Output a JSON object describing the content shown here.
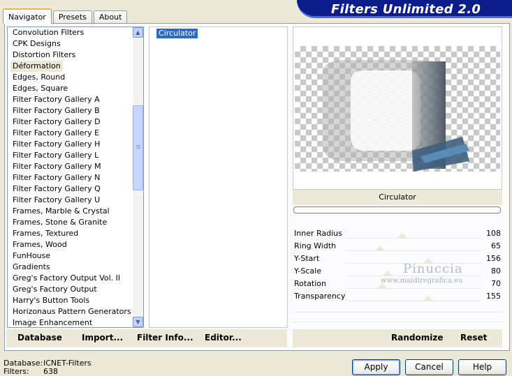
{
  "window": {
    "banner_title": "Filters Unlimited 2.0"
  },
  "tabs": [
    {
      "label": "Navigator",
      "active": true
    },
    {
      "label": "Presets",
      "active": false
    },
    {
      "label": "About",
      "active": false
    }
  ],
  "categories": {
    "items": [
      "Convolution Filters",
      "CPK Designs",
      "Distortion Filters",
      "Déformation",
      "Edges, Round",
      "Edges, Square",
      "Filter Factory Gallery A",
      "Filter Factory Gallery B",
      "Filter Factory Gallery D",
      "Filter Factory Gallery E",
      "Filter Factory Gallery H",
      "Filter Factory Gallery L",
      "Filter Factory Gallery M",
      "Filter Factory Gallery N",
      "Filter Factory Gallery Q",
      "Filter Factory Gallery U",
      "Frames, Marble & Crystal",
      "Frames, Stone & Granite",
      "Frames, Textured",
      "Frames, Wood",
      "FunHouse",
      "Gradients",
      "Greg's Factory Output Vol. II",
      "Greg's Factory Output",
      "Harry's Button Tools",
      "Horizonaus Pattern Generators",
      "Image Enhancement"
    ],
    "selected": "Déformation",
    "scroll_up_icon": "arrow-up-icon",
    "scroll_down_icon": "arrow-down-icon"
  },
  "filters": {
    "items": [
      "Circulator"
    ],
    "selected": "Circulator"
  },
  "preview": {
    "filter_name": "Circulator"
  },
  "parameters": [
    {
      "label": "Inner Radius",
      "value": "108",
      "level": 0.42
    },
    {
      "label": "Ring Width",
      "value": "65",
      "level": 0.25
    },
    {
      "label": "Y-Start",
      "value": "156",
      "level": 0.61
    },
    {
      "label": "Y-Scale",
      "value": "80",
      "level": 0.31
    },
    {
      "label": "Rotation",
      "value": "70",
      "level": 0.27
    },
    {
      "label": "Transparency",
      "value": "155",
      "level": 0.61
    }
  ],
  "toolbar": {
    "database": "Database",
    "import": "Import...",
    "filter_info": "Filter Info...",
    "editor": "Editor...",
    "randomize": "Randomize",
    "reset": "Reset"
  },
  "status": {
    "database_label": "Database:",
    "database_value": "ICNET-Filters",
    "filters_label": "Filters:",
    "filters_value": "638"
  },
  "buttons": {
    "apply": "Apply",
    "cancel": "Cancel",
    "help": "Help"
  },
  "watermark": {
    "name": "Pinuccia",
    "url": "www.maidiregrafica.eu"
  }
}
